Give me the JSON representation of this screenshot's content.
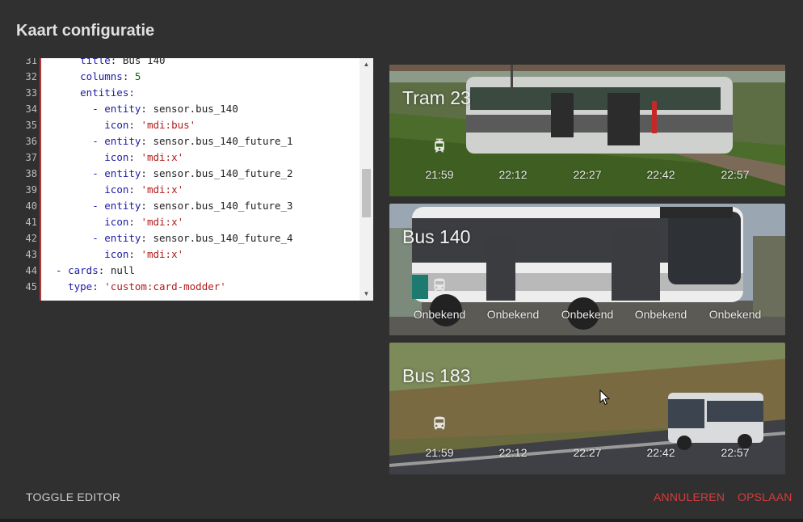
{
  "dialog": {
    "title": "Kaart configuratie"
  },
  "editor": {
    "lines": [
      {
        "n": "31",
        "parts": [
          [
            "      ",
            "p"
          ],
          [
            "title",
            "k"
          ],
          [
            ": ",
            "p"
          ],
          [
            "Bus 140",
            "p"
          ]
        ]
      },
      {
        "n": "32",
        "parts": [
          [
            "      ",
            "p"
          ],
          [
            "columns",
            "k"
          ],
          [
            ": ",
            "p"
          ],
          [
            "5",
            "n"
          ]
        ]
      },
      {
        "n": "33",
        "parts": [
          [
            "      ",
            "p"
          ],
          [
            "entities",
            "k"
          ],
          [
            ":",
            "k"
          ]
        ]
      },
      {
        "n": "34",
        "parts": [
          [
            "        - ",
            "k"
          ],
          [
            "entity",
            "k"
          ],
          [
            ": ",
            "p"
          ],
          [
            "sensor.bus_140",
            "p"
          ]
        ]
      },
      {
        "n": "35",
        "parts": [
          [
            "          ",
            "p"
          ],
          [
            "icon",
            "k"
          ],
          [
            ": ",
            "p"
          ],
          [
            "'mdi:bus'",
            "s"
          ]
        ]
      },
      {
        "n": "36",
        "parts": [
          [
            "        - ",
            "k"
          ],
          [
            "entity",
            "k"
          ],
          [
            ": ",
            "p"
          ],
          [
            "sensor.bus_140_future_1",
            "p"
          ]
        ]
      },
      {
        "n": "37",
        "parts": [
          [
            "          ",
            "p"
          ],
          [
            "icon",
            "k"
          ],
          [
            ": ",
            "p"
          ],
          [
            "'mdi:x'",
            "s"
          ]
        ]
      },
      {
        "n": "38",
        "parts": [
          [
            "        - ",
            "k"
          ],
          [
            "entity",
            "k"
          ],
          [
            ": ",
            "p"
          ],
          [
            "sensor.bus_140_future_2",
            "p"
          ]
        ]
      },
      {
        "n": "39",
        "parts": [
          [
            "          ",
            "p"
          ],
          [
            "icon",
            "k"
          ],
          [
            ": ",
            "p"
          ],
          [
            "'mdi:x'",
            "s"
          ]
        ]
      },
      {
        "n": "40",
        "parts": [
          [
            "        - ",
            "k"
          ],
          [
            "entity",
            "k"
          ],
          [
            ": ",
            "p"
          ],
          [
            "sensor.bus_140_future_3",
            "p"
          ]
        ]
      },
      {
        "n": "41",
        "parts": [
          [
            "          ",
            "p"
          ],
          [
            "icon",
            "k"
          ],
          [
            ": ",
            "p"
          ],
          [
            "'mdi:x'",
            "s"
          ]
        ]
      },
      {
        "n": "42",
        "parts": [
          [
            "        - ",
            "k"
          ],
          [
            "entity",
            "k"
          ],
          [
            ": ",
            "p"
          ],
          [
            "sensor.bus_140_future_4",
            "p"
          ]
        ]
      },
      {
        "n": "43",
        "parts": [
          [
            "          ",
            "p"
          ],
          [
            "icon",
            "k"
          ],
          [
            ": ",
            "p"
          ],
          [
            "'mdi:x'",
            "s"
          ]
        ]
      },
      {
        "n": "44",
        "parts": [
          [
            "  - ",
            "k"
          ],
          [
            "cards",
            "k"
          ],
          [
            ": ",
            "p"
          ],
          [
            "null",
            "p"
          ]
        ]
      },
      {
        "n": "45",
        "parts": [
          [
            "    ",
            "p"
          ],
          [
            "type",
            "k"
          ],
          [
            ": ",
            "p"
          ],
          [
            "'custom:card-modder'",
            "s"
          ]
        ]
      }
    ]
  },
  "cards": [
    {
      "title": "Tram 23",
      "icon": "tram-icon",
      "times": [
        "21:59",
        "22:12",
        "22:27",
        "22:42",
        "22:57"
      ]
    },
    {
      "title": "Bus 140",
      "icon": "bus-icon",
      "times": [
        "Onbekend",
        "Onbekend",
        "Onbekend",
        "Onbekend",
        "Onbekend"
      ]
    },
    {
      "title": "Bus 183",
      "icon": "bus-icon",
      "times": [
        "21:59",
        "22:12",
        "22:27",
        "22:42",
        "22:57"
      ]
    }
  ],
  "footer": {
    "toggle_label": "TOGGLE EDITOR",
    "cancel_label": "ANNULEREN",
    "save_label": "OPSLAAN"
  },
  "colors": {
    "accent": "#d93b3b",
    "dialog_bg": "#303030",
    "key": "#1a1aa6",
    "string": "#b11a1a",
    "number": "#116611"
  }
}
